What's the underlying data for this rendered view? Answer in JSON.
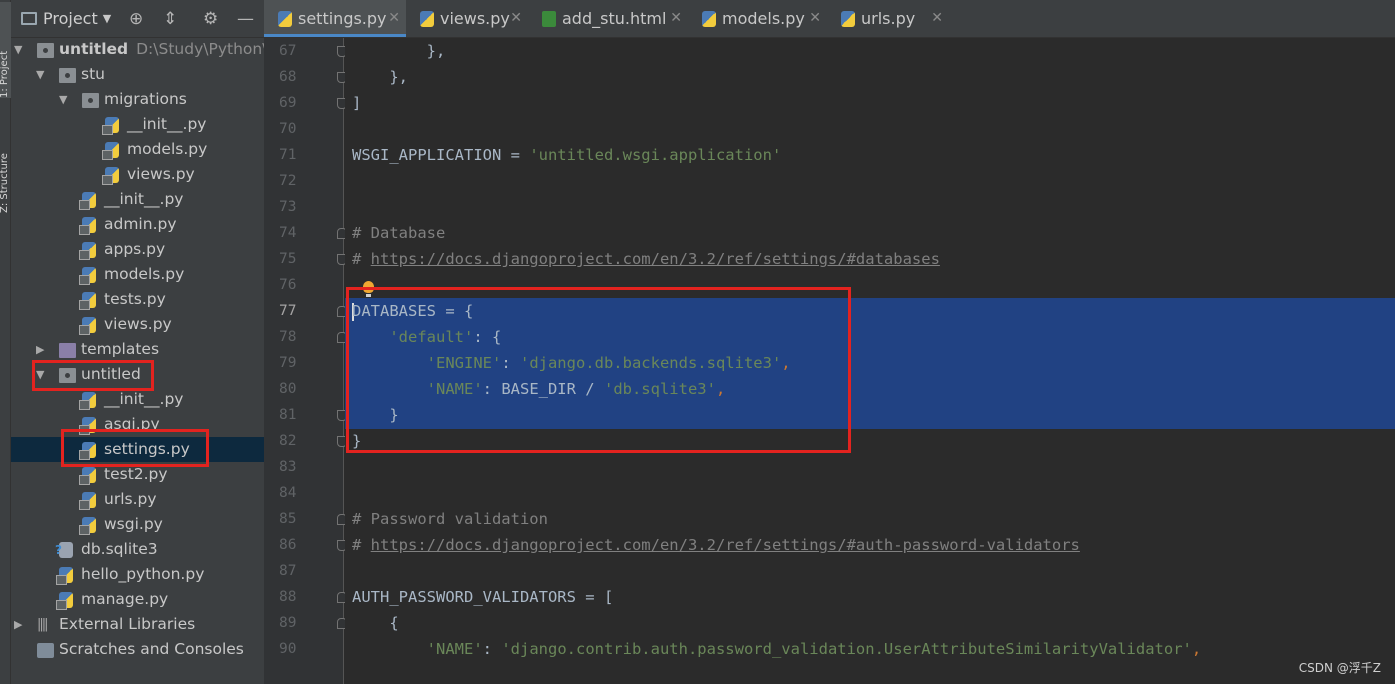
{
  "strip": {
    "label_top": "1: Project",
    "label_bottom": "Z: Structure"
  },
  "panel": {
    "title": "Project"
  },
  "tree": [
    {
      "label": "untitled",
      "sub": "D:\\Study\\Python\\p",
      "icon": "folder-icon",
      "arrow": "▼",
      "bold": true
    },
    {
      "label": "stu",
      "icon": "folder-icon",
      "arrow": "▼"
    },
    {
      "label": "migrations",
      "icon": "folder-icon",
      "arrow": "▼"
    },
    {
      "label": "__init__.py",
      "icon": "python-file-icon"
    },
    {
      "label": "models.py",
      "icon": "python-file-icon"
    },
    {
      "label": "views.py",
      "icon": "python-file-icon"
    },
    {
      "label": "__init__.py",
      "icon": "python-file-icon"
    },
    {
      "label": "admin.py",
      "icon": "python-file-icon"
    },
    {
      "label": "apps.py",
      "icon": "python-file-icon"
    },
    {
      "label": "models.py",
      "icon": "python-file-icon"
    },
    {
      "label": "tests.py",
      "icon": "python-file-icon"
    },
    {
      "label": "views.py",
      "icon": "python-file-icon"
    },
    {
      "label": "templates",
      "icon": "template-folder-icon",
      "arrow": "▶"
    },
    {
      "label": "untitled",
      "icon": "folder-icon",
      "arrow": "▼"
    },
    {
      "label": "__init__.py",
      "icon": "python-file-icon"
    },
    {
      "label": "asgi.py",
      "icon": "python-file-icon"
    },
    {
      "label": "settings.py",
      "icon": "python-file-icon",
      "selected": true
    },
    {
      "label": "test2.py",
      "icon": "python-file-icon"
    },
    {
      "label": "urls.py",
      "icon": "python-file-icon"
    },
    {
      "label": "wsgi.py",
      "icon": "python-file-icon"
    },
    {
      "label": "db.sqlite3",
      "icon": "database-file-icon"
    },
    {
      "label": "hello_python.py",
      "icon": "python-file-icon"
    },
    {
      "label": "manage.py",
      "icon": "python-file-icon"
    },
    {
      "label": "External Libraries",
      "icon": "library-icon",
      "arrow": "▶"
    },
    {
      "label": "Scratches and Consoles",
      "icon": "scratches-icon"
    }
  ],
  "tabs": [
    {
      "label": "settings.py",
      "icon": "python-file-icon",
      "active": true
    },
    {
      "label": "views.py",
      "icon": "python-file-icon"
    },
    {
      "label": "add_stu.html",
      "icon": "html-file-icon"
    },
    {
      "label": "models.py",
      "icon": "python-file-icon"
    },
    {
      "label": "urls.py",
      "icon": "python-file-icon"
    }
  ],
  "gutter": {
    "line_numbers": [
      "67",
      "68",
      "69",
      "70",
      "71",
      "72",
      "73",
      "74",
      "75",
      "76",
      "77",
      "78",
      "79",
      "80",
      "81",
      "82",
      "83",
      "84",
      "85",
      "86",
      "87",
      "88",
      "89",
      "90"
    ],
    "current_line": "77"
  },
  "code": {
    "l67": "        },",
    "l68": "    },",
    "l69": "]",
    "l71_name": "WSGI_APPLICATION = ",
    "l71_str": "'untitled.wsgi.application'",
    "l74": "# Database",
    "l75_prefix": "# ",
    "l75_url": "https://docs.djangoproject.com/en/3.2/ref/settings/#databases",
    "l77": "DATABASES = {",
    "l78_indent": "    ",
    "l78_str": "'default'",
    "l78_rest": ": {",
    "l79_indent": "        ",
    "l79_key": "'ENGINE'",
    "l79_sep": ": ",
    "l79_val": "'django.db.backends.sqlite3'",
    "l79_comma": ",",
    "l80_indent": "        ",
    "l80_key": "'NAME'",
    "l80_mid": ": BASE_DIR / ",
    "l80_val": "'db.sqlite3'",
    "l80_comma": ",",
    "l81": "    }",
    "l82": "}",
    "l85": "# Password validation",
    "l86_prefix": "# ",
    "l86_url": "https://docs.djangoproject.com/en/3.2/ref/settings/#auth-password-validators",
    "l88": "AUTH_PASSWORD_VALIDATORS = [",
    "l89": "    {",
    "l90_indent": "        ",
    "l90_key": "'NAME'",
    "l90_sep": ": ",
    "l90_val": "'django.contrib.auth.password_validation.UserAttributeSimilarityValidator'",
    "l90_comma": ","
  },
  "watermark": "CSDN @浮千Z",
  "colors": {
    "highlight_box": "#e3231f",
    "selection": "#214283",
    "selected_row": "#0d293e"
  }
}
